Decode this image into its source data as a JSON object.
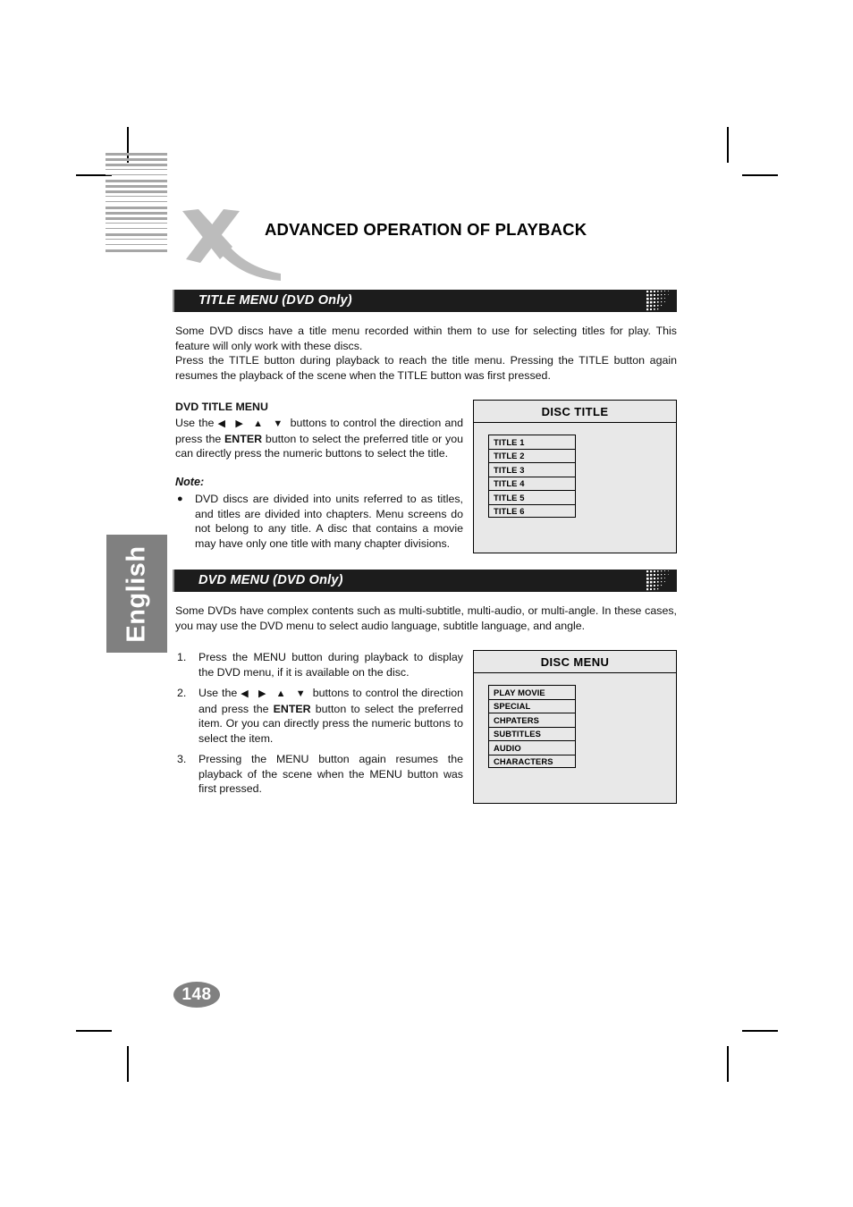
{
  "document": {
    "title": "ADVANCED OPERATION OF PLAYBACK",
    "language_tab": "English",
    "page_number": "148",
    "logo": "x-logo"
  },
  "sections": [
    {
      "id": "title-menu",
      "heading": "TITLE MENU (DVD Only)",
      "paragraphs": [
        "Some DVD discs have a title menu recorded within them to use for selecting titles for play. This feature will only work with these discs.",
        "Press the TITLE button during playback to reach the title menu. Pressing the TITLE button again resumes the playback of the scene when the TITLE button was first pressed."
      ],
      "subheading": "DVD TITLE MENU",
      "instruction_prefix": "Use the",
      "arrows": "◀  ▶  ▲  ▼",
      "instruction_part1": "buttons to control the direction and press the",
      "enter_label": "ENTER",
      "instruction_part2": "button to select the preferred title or you can directly press the numeric buttons to select the title.",
      "note_label": "Note:",
      "note_bullet": "●",
      "note_text": "DVD discs are divided into units referred to as titles, and titles are divided into chapters. Menu screens do not belong to any title. A disc that contains a movie may have only one title with many chapter divisions."
    },
    {
      "id": "dvd-menu",
      "heading": "DVD MENU (DVD Only)",
      "paragraphs": [
        "Some DVDs have complex contents such as multi-subtitle, multi-audio, or multi-angle.   In these cases, you may use the DVD menu to select audio language, subtitle language, and angle."
      ],
      "steps": [
        {
          "number": "1.",
          "text": "Press the MENU button during playback to display the DVD menu, if it is available on the disc."
        },
        {
          "number": "2.",
          "prefix": "Use the",
          "arrows": "◀  ▶  ▲  ▼",
          "part1": "buttons to control the direction and press the",
          "enter_label": "ENTER",
          "part2": "button to select the preferred item. Or you can directly press the numeric buttons to select the item."
        },
        {
          "number": "3.",
          "text": "Pressing the MENU button again resumes the playback of the scene when the MENU button was first pressed."
        }
      ]
    }
  ],
  "osd_screens": [
    {
      "id": "disc-title",
      "header": "DISC TITLE",
      "items": [
        "TITLE 1",
        "TITLE 2",
        "TITLE 3",
        "TITLE 4",
        "TITLE 5",
        "TITLE 6"
      ]
    },
    {
      "id": "disc-menu",
      "header": "DISC MENU",
      "items": [
        "PLAY MOVIE",
        "SPECIAL",
        "CHPATERS",
        "SUBTITLES",
        "AUDIO",
        "CHARACTERS"
      ]
    }
  ],
  "colors": {
    "bar_background": "#1c1c1c",
    "accent_gray": "#808080",
    "logo_gray": "#bcbcbc",
    "osd_background": "#e8e8e8",
    "stripe_gray": "#a6a6a6"
  }
}
